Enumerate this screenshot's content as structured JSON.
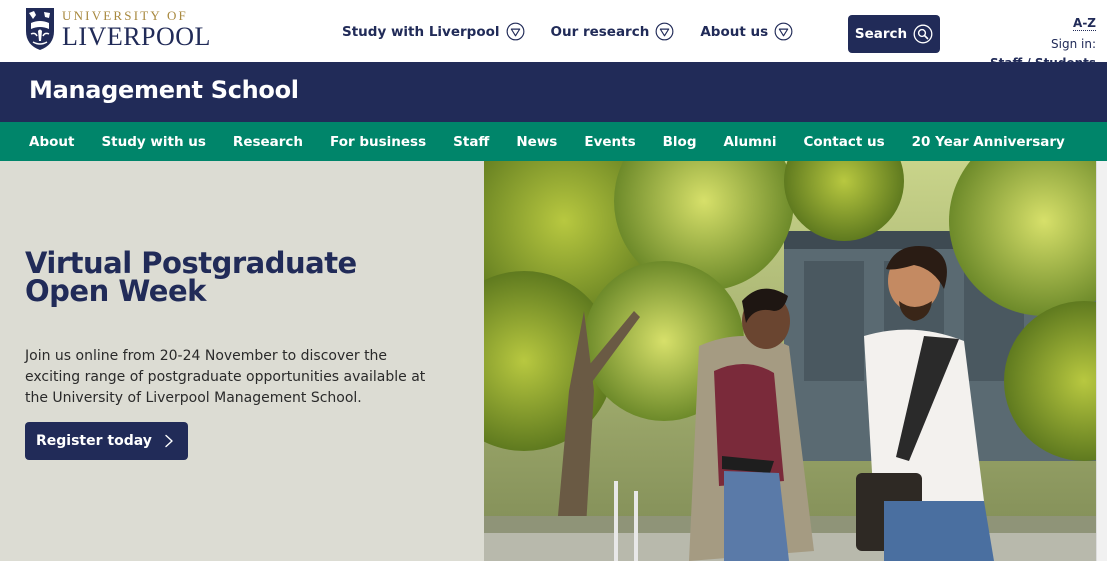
{
  "logo": {
    "top_text": "UNIVERSITY OF",
    "bottom_text": "LIVERPOOL"
  },
  "topnav": {
    "items": [
      {
        "label": "Study with Liverpool"
      },
      {
        "label": "Our research"
      },
      {
        "label": "About us"
      }
    ]
  },
  "search": {
    "label": "Search"
  },
  "utility": {
    "az": "A-Z",
    "sign_in": "Sign in:",
    "staff": "Staff",
    "separator": " / ",
    "students": "Students"
  },
  "school": {
    "title": "Management School"
  },
  "green_nav": {
    "items": [
      {
        "label": "About"
      },
      {
        "label": "Study with us"
      },
      {
        "label": "Research"
      },
      {
        "label": "For business"
      },
      {
        "label": "Staff"
      },
      {
        "label": "News"
      },
      {
        "label": "Events"
      },
      {
        "label": "Blog"
      },
      {
        "label": "Alumni"
      },
      {
        "label": "Contact us"
      },
      {
        "label": "20 Year Anniversary"
      }
    ]
  },
  "hero": {
    "title_line1": "Virtual Postgraduate",
    "title_line2": "Open Week",
    "description": "Join us online from 20-24 November to discover the exciting range of postgraduate opportunities available at the University of Liverpool Management School.",
    "cta_label": "Register today"
  },
  "colors": {
    "navy": "#212b58",
    "green": "#00856a",
    "hero_bg": "#dcdcd3",
    "gold": "#a8893f"
  }
}
